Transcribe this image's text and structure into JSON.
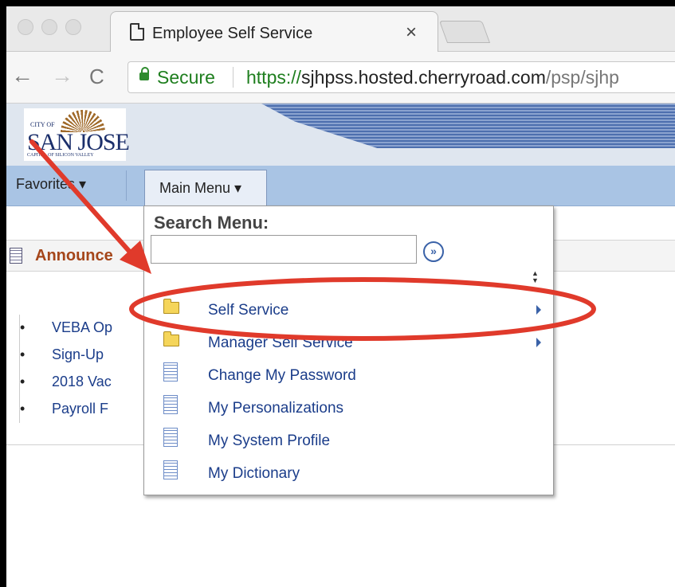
{
  "browser": {
    "tab": {
      "title": "Employee Self Service",
      "close": "×"
    },
    "nav": {
      "back": "←",
      "forward": "→",
      "reload": "C"
    },
    "address": {
      "secure_label": "Secure",
      "scheme": "https://",
      "host": "sjhpss.hosted.cherryroad.com",
      "path": "/psp/sjhp"
    }
  },
  "header": {
    "logo": {
      "line1": "CITY OF",
      "line2": "SAN JOSE",
      "line3": "CAPITAL OF SILICON VALLEY"
    }
  },
  "menubar": {
    "favorites": "Favorites ▾",
    "main_menu": "Main Menu ▾"
  },
  "announcements": {
    "title": "Announce",
    "items": [
      "VEBA Op",
      "Sign-Up",
      "2018 Vac",
      "Payroll F"
    ]
  },
  "dropdown": {
    "search_label": "Search Menu:",
    "search_placeholder": "",
    "go_symbol": "»",
    "items": [
      {
        "label": "Self Service",
        "icon": "folder-icon",
        "submenu": true
      },
      {
        "label": "Manager Self Service",
        "icon": "folder-icon",
        "submenu": true
      },
      {
        "label": "Change My Password",
        "icon": "document-icon",
        "submenu": false
      },
      {
        "label": "My Personalizations",
        "icon": "document-icon",
        "submenu": false
      },
      {
        "label": "My System Profile",
        "icon": "document-icon",
        "submenu": false
      },
      {
        "label": "My Dictionary",
        "icon": "document-icon",
        "submenu": false
      }
    ]
  },
  "annotations": {
    "arrow_color": "#e03a2b",
    "ellipse_color": "#e03a2b"
  }
}
